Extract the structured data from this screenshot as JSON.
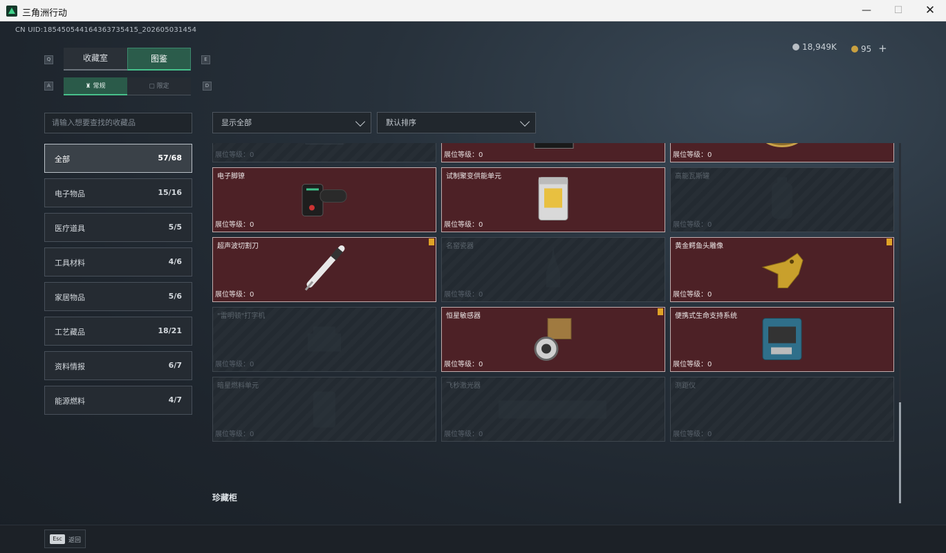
{
  "window": {
    "title": "三角洲行动",
    "min": "—",
    "max": "☐",
    "close": "✕"
  },
  "header": {
    "uid": "CN UID:18545054416436373541​5_202605031454",
    "silver": "18,949K",
    "gold": "95",
    "plus": "+"
  },
  "tabs": {
    "left_key": "Q",
    "right_key": "E",
    "items": [
      {
        "label": "收藏室"
      },
      {
        "label": "图鉴"
      }
    ]
  },
  "subtabs": {
    "left_key": "A",
    "right_key": "D",
    "items": [
      {
        "label": "常规"
      },
      {
        "label": "限定"
      }
    ]
  },
  "search": {
    "placeholder": "请输入想要查找的收藏品"
  },
  "categories": [
    {
      "name": "全部",
      "count": "57/68"
    },
    {
      "name": "电子物品",
      "count": "15/16"
    },
    {
      "name": "医疗道具",
      "count": "5/5"
    },
    {
      "name": "工具材料",
      "count": "4/6"
    },
    {
      "name": "家居物品",
      "count": "5/6"
    },
    {
      "name": "工艺藏品",
      "count": "18/21"
    },
    {
      "name": "资料情报",
      "count": "6/7"
    },
    {
      "name": "能源燃料",
      "count": "4/7"
    }
  ],
  "filters": {
    "show": "显示全部",
    "sort": "默认排序"
  },
  "level_label": "展位等级：0",
  "cards": [
    {
      "name": "",
      "owned": false,
      "icon": "circuit-board-icon"
    },
    {
      "name": "",
      "owned": true,
      "icon": "tape-recorder-icon"
    },
    {
      "name": "",
      "owned": true,
      "icon": "golden-nest-icon"
    },
    {
      "name": "电子脚镣",
      "owned": true,
      "icon": "ankle-monitor-icon"
    },
    {
      "name": "试制聚变供能单元",
      "owned": true,
      "icon": "fusion-cell-icon"
    },
    {
      "name": "高能瓦斯罐",
      "owned": false,
      "icon": "gas-canister-icon"
    },
    {
      "name": "超声波切割刀",
      "owned": true,
      "icon": "ultrasonic-cutter-icon",
      "badge": true
    },
    {
      "name": "名窑瓷器",
      "owned": false,
      "icon": "porcelain-vase-icon"
    },
    {
      "name": "黄金鳄鱼头雕像",
      "owned": true,
      "icon": "gold-croc-statue-icon",
      "badge": true
    },
    {
      "name": "\"雷明顿\"打字机",
      "owned": false,
      "icon": "typewriter-icon"
    },
    {
      "name": "恒星敏感器",
      "owned": true,
      "icon": "star-sensor-icon",
      "badge": true
    },
    {
      "name": "便携式生命支持系统",
      "owned": true,
      "icon": "life-support-icon"
    },
    {
      "name": "暗星燃料单元",
      "owned": false,
      "icon": "fuel-cell-icon"
    },
    {
      "name": "飞秒激光器",
      "owned": false,
      "icon": "laser-icon"
    },
    {
      "name": "测距仪",
      "owned": false,
      "icon": "rangefinder-icon"
    }
  ],
  "section_title": "珍藏柜",
  "footer": {
    "esc": "Esc",
    "back": "返回"
  },
  "colors": {
    "accent": "#46c18c",
    "owned_card": "#4d2126",
    "badge": "#e0a326"
  }
}
